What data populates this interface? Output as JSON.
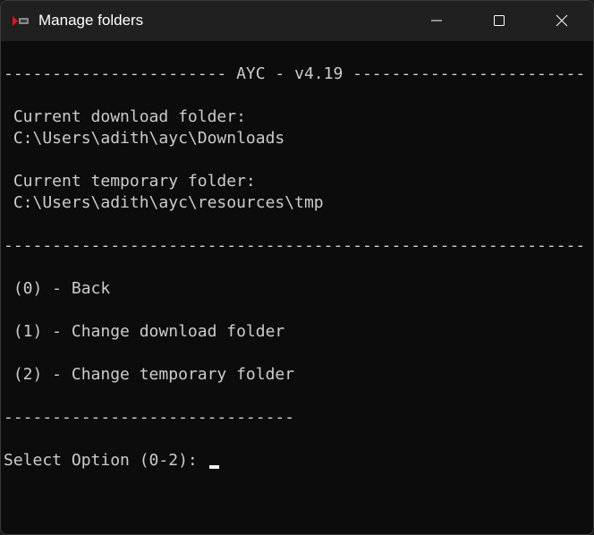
{
  "window": {
    "title": "Manage folders",
    "icon": "youtube-play-icon",
    "controls": {
      "minimize_icon": "minimize-icon",
      "maximize_icon": "maximize-icon",
      "close_icon": "close-icon"
    }
  },
  "console": {
    "header_line": "----------------------- AYC - v4.19 -----------------------------",
    "download_label": " Current download folder:",
    "download_path": " C:\\Users\\adith\\ayc\\Downloads",
    "temp_label": " Current temporary folder:",
    "temp_path": " C:\\Users\\adith\\ayc\\resources\\tmp",
    "separator_line": "-------------------------------------------------------------------",
    "options": [
      " (0) - Back",
      " (1) - Change download folder",
      " (2) - Change temporary folder"
    ],
    "short_separator": "------------------------------",
    "prompt": "Select Option (0-2): "
  },
  "colors": {
    "titlebar": "#202020",
    "console_background": "#0c0c0c",
    "text": "#cccccc",
    "icon_red": "#e81123"
  }
}
